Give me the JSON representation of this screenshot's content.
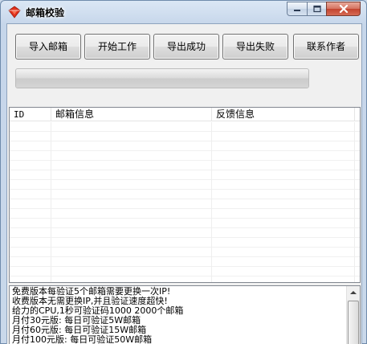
{
  "window": {
    "title": "邮箱校验",
    "icon": "red-diamond-app-icon",
    "close_color": "#c3432e"
  },
  "toolbar": {
    "buttons": [
      {
        "label": "导入邮箱"
      },
      {
        "label": "开始工作"
      },
      {
        "label": "导出成功"
      },
      {
        "label": "导出失败"
      },
      {
        "label": "联系作者"
      }
    ]
  },
  "progress": {
    "fraction": 1.0
  },
  "list": {
    "columns": [
      {
        "label": "ID"
      },
      {
        "label": "邮箱信息"
      },
      {
        "label": "反馈信息"
      }
    ],
    "rows": []
  },
  "log": {
    "lines": [
      "免费版本每验证5个邮箱需要更换一次IP!",
      "收费版本无需更换IP,并且验证速度超快!",
      "给力的CPU,1秒可验证码1000 2000个邮箱",
      "月付30元版: 每日可验证5W邮箱",
      "月付60元版: 每日可验证15W邮箱",
      "月付100元版: 每日可验证50W邮箱"
    ]
  }
}
